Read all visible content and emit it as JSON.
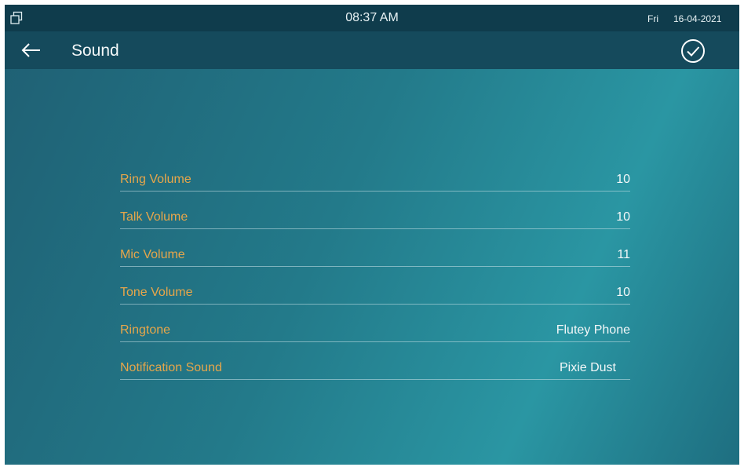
{
  "status_bar": {
    "icon": "window-icon",
    "time": "08:37 AM",
    "day": "Fri",
    "date": "16-04-2021"
  },
  "title_bar": {
    "back_icon": "arrow-left-icon",
    "title": "Sound",
    "confirm_icon": "check-circle-icon"
  },
  "settings": [
    {
      "label": "Ring Volume",
      "value": "10"
    },
    {
      "label": "Talk Volume",
      "value": "10"
    },
    {
      "label": "Mic Volume",
      "value": "11"
    },
    {
      "label": "Tone Volume",
      "value": "10"
    },
    {
      "label": "Ringtone",
      "value": "Flutey Phone"
    },
    {
      "label": "Notification Sound",
      "value": "Pixie Dust"
    }
  ],
  "colors": {
    "status_bar": "#0f3c4c",
    "title_bar": "#154a5c",
    "label": "#e7a64a",
    "value": "#f3f7f8"
  }
}
